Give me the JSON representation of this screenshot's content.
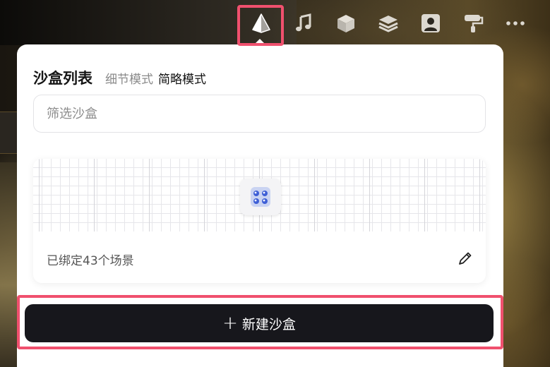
{
  "toolbar": {
    "items": [
      {
        "icon": "pyramid-icon",
        "active": true
      },
      {
        "icon": "music-note-icon"
      },
      {
        "icon": "cube-icon"
      },
      {
        "icon": "layers-icon"
      },
      {
        "icon": "user-portrait-icon"
      },
      {
        "icon": "paint-roller-icon"
      },
      {
        "icon": "more-dots-icon"
      }
    ]
  },
  "panel": {
    "title": "沙盒列表",
    "modes": [
      "细节模式",
      "简略模式"
    ],
    "active_mode": "简略模式",
    "filter_placeholder": "筛选沙盒",
    "card": {
      "caption": "已绑定43个场景"
    },
    "create_button": {
      "icon": "plus",
      "label": "新建沙盒"
    }
  },
  "colors": {
    "highlight": "#f0506e",
    "button_bg": "#17171c"
  }
}
